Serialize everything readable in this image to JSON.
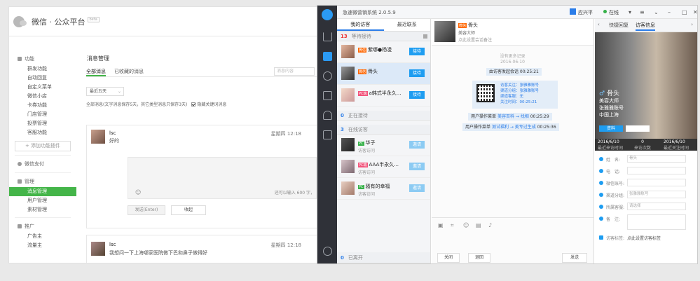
{
  "wechat": {
    "title": "微信 · 公众平台",
    "beta": "beta",
    "sidebar": {
      "function_group": "功能",
      "function_items": [
        "群发功能",
        "自动回复",
        "自定义菜单",
        "微信小店",
        "卡券功能",
        "门店管理",
        "投票管理",
        "客服功能"
      ],
      "add_plugin": "+ 添加功能插件",
      "pay": "微信支付",
      "manage_group": "管理",
      "manage_items": [
        "消息管理",
        "用户管理",
        "素材管理"
      ],
      "promo_group": "推广",
      "promo_items": [
        "广告主",
        "流量主"
      ]
    },
    "main": {
      "title": "消息管理",
      "tabs": [
        "全部消息",
        "已收藏的消息"
      ],
      "search_placeholder": "消息内容",
      "filter": "最近五天",
      "note": "全部消息(文字消息保存5天，其它类型消息只保存3天)",
      "hide_keyword": "隐藏关键词消息",
      "msg1": {
        "name": "lsc",
        "text": "好的",
        "time": "星期四 12:18"
      },
      "hint": "还可以输入 600 字，",
      "send_btn": "发送(Enter)",
      "collapse_btn": "收起",
      "msg2": {
        "name": "lsc",
        "text": "我想问一下上海哪家医院做下巴和鼻子做得好",
        "time": "星期四 12:18"
      }
    }
  },
  "app": {
    "title": "急速微营销系统 2.0.5.9",
    "user": "应兴平",
    "status": "在线",
    "tabs": [
      "我的访客",
      "最近联系"
    ],
    "waiting": {
      "count": "13",
      "label": "等待接待"
    },
    "waiting_list": [
      {
        "tag": "微信",
        "name": "紫哪●杨凌",
        "btn": "接待"
      },
      {
        "tag": "微信",
        "name": "骨头",
        "btn": "接待"
      },
      {
        "tag": "PC端",
        "name": "a韩式半永久...",
        "btn": "接待"
      }
    ],
    "serving": {
      "count": "0",
      "label": "正在接待"
    },
    "visited": {
      "count": "3",
      "label": "在线访客"
    },
    "visited_list": [
      {
        "tag": "PC",
        "name": "华子",
        "sub": "访客访问",
        "btn": "邀请"
      },
      {
        "tag": "PC端",
        "name": "AAA半永久...",
        "sub": "访客访问",
        "btn": "邀请"
      },
      {
        "tag": "PC",
        "name": "骚有的幸福",
        "sub": "访客访问",
        "btn": "邀请"
      }
    ],
    "left_footer": {
      "count": "0",
      "label": "已离开"
    },
    "chat": {
      "tag": "微信",
      "name": "骨头",
      "sub1": "美容大师",
      "sub2": "点此设置会话备注",
      "more": "没有更多记录",
      "date": "2016-06-10",
      "sys1": "由访客发起会话 00:25:21",
      "qr_lines": [
        "访客关注：张雅雅账号",
        "渠道分组：张雅雅账号",
        "渠道客服：无",
        "关注时间：00:25:21"
      ],
      "op1_label": "用户操作菜单",
      "op1_link": "美容百科 → 找相",
      "op1_time": "00:25:29",
      "op2_label": "用户操作菜单",
      "op2_link": "测试福利 → 美专过生成",
      "op2_time": "00:25:36",
      "close_btn": "关闭",
      "back_btn": "退回",
      "send_btn": "发送"
    },
    "info": {
      "tabs": [
        "快捷回复",
        "访客信息"
      ],
      "name": "骨头",
      "title1": "美容大师",
      "title2": "张雅雅账号",
      "location": "中国上海",
      "edit": "资料",
      "stats": [
        {
          "value": "2016/6/10",
          "label": "最近来访时间"
        },
        {
          "value": "0",
          "label": "来访次数"
        },
        {
          "value": "2016/6/10",
          "label": "最近关注时间"
        }
      ],
      "fields": [
        {
          "label": "姓　名:",
          "value": "骨头"
        },
        {
          "label": "电　话:",
          "value": ""
        },
        {
          "label": "微信账号:",
          "value": ""
        },
        {
          "label": "渠道分组:",
          "value": "张雅雅账号"
        },
        {
          "label": "所属客服:",
          "value": "请选择"
        },
        {
          "label": "备　注:",
          "value": ""
        }
      ],
      "visitor_tag_label": "访客标签:",
      "visitor_tag_value": "点此设置访客标签"
    }
  }
}
